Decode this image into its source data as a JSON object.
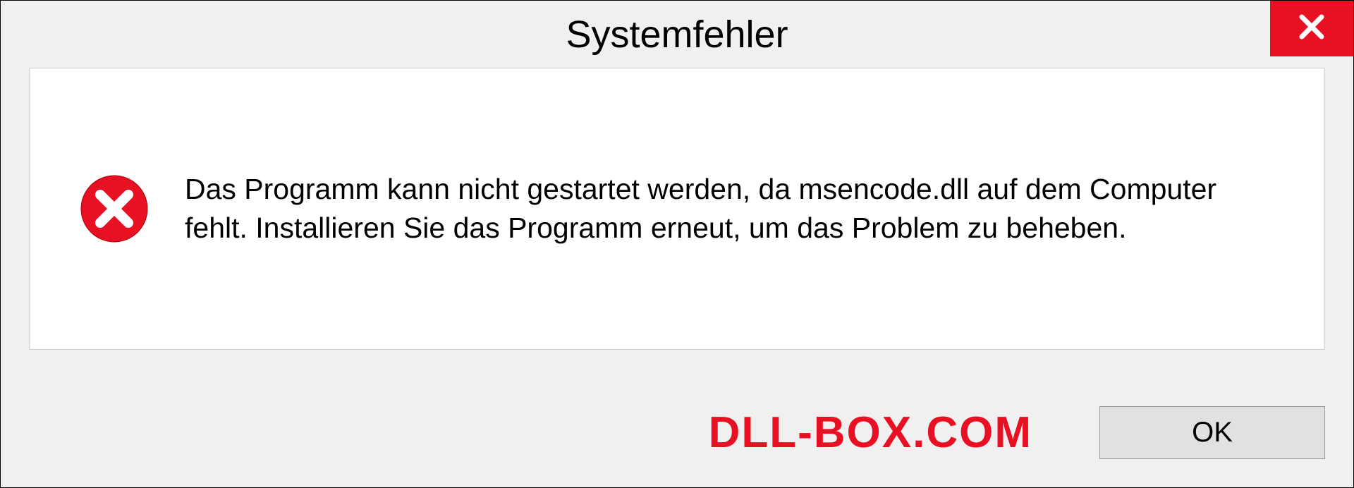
{
  "dialog": {
    "title": "Systemfehler",
    "message": "Das Programm kann nicht gestartet werden, da msencode.dll auf dem Computer fehlt. Installieren Sie das Programm erneut, um das Problem zu beheben.",
    "ok_label": "OK"
  },
  "watermark": "DLL-BOX.COM"
}
